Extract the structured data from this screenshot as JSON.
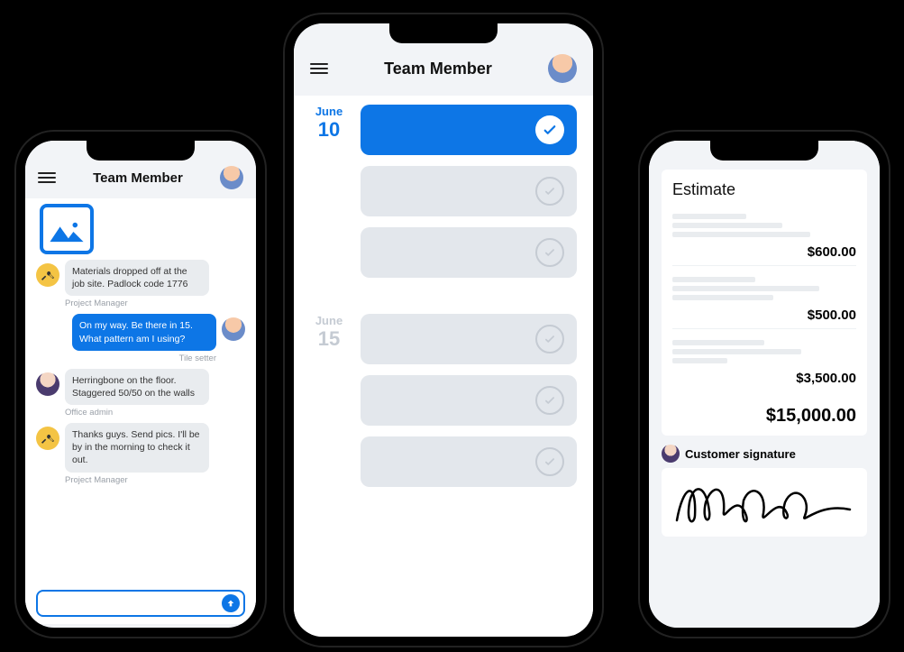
{
  "header": {
    "title": "Team Member"
  },
  "chat": {
    "messages": [
      {
        "text": "Materials dropped off at the job site. Padlock code 1776",
        "role": "Project Manager"
      },
      {
        "text": "On my way. Be there in 15. What pattern am I using?",
        "role": "Tile setter"
      },
      {
        "text": "Herringbone on the floor. Staggered 50/50 on the walls",
        "role": "Office admin"
      },
      {
        "text": "Thanks guys. Send pics. I'll be by in the morning to check it out.",
        "role": "Project Manager"
      }
    ]
  },
  "calendar": {
    "dates": [
      {
        "month": "June",
        "day": "10"
      },
      {
        "month": "June",
        "day": "15"
      }
    ]
  },
  "estimate": {
    "title": "Estimate",
    "items": [
      {
        "amount": "$600.00"
      },
      {
        "amount": "$500.00"
      },
      {
        "amount": "$3,500.00"
      }
    ],
    "total": "$15,000.00",
    "signature_label": "Customer signature"
  }
}
